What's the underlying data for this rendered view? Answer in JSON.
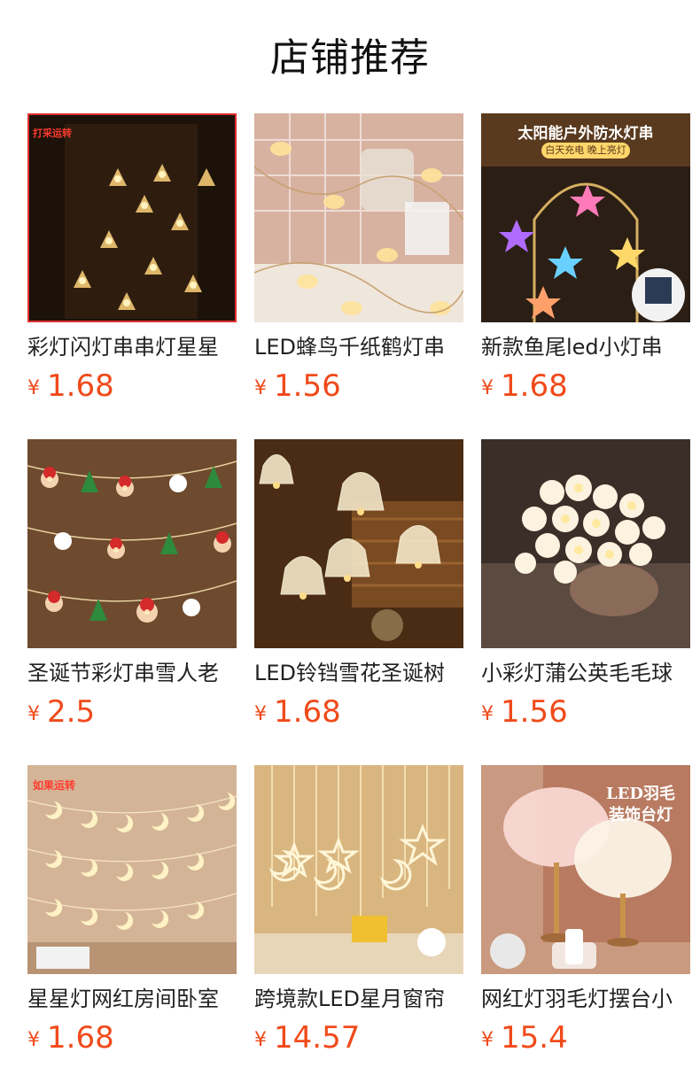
{
  "header": {
    "title": "店铺推荐"
  },
  "currency_symbol": "¥",
  "products": [
    {
      "name": "彩灯闪灯串串灯星星",
      "price": "1.68",
      "badge": "打采运转",
      "theme": "tree-lights"
    },
    {
      "name": "LED蜂鸟千纸鹤灯串",
      "price": "1.56",
      "theme": "bird-lights"
    },
    {
      "name": "新款鱼尾led小灯串",
      "price": "1.68",
      "banner_title": "太阳能户外防水灯串",
      "banner_sub": "白天充电  晚上亮灯",
      "theme": "starfish-lights"
    },
    {
      "name": "圣诞节彩灯串雪人老",
      "price": "2.5",
      "theme": "santa-lights"
    },
    {
      "name": "LED铃铛雪花圣诞树",
      "price": "1.68",
      "theme": "bell-lights"
    },
    {
      "name": "小彩灯蒲公英毛毛球",
      "price": "1.56",
      "theme": "dandelion-lights"
    },
    {
      "name": "星星灯网红房间卧室",
      "price": "1.68",
      "badge": "如果运转",
      "theme": "moon-lights"
    },
    {
      "name": "跨境款LED星月窗帘",
      "price": "14.57",
      "theme": "curtain-lights"
    },
    {
      "name": "网红灯羽毛灯摆台小",
      "price": "15.4",
      "banner_title_1": "LED羽毛",
      "banner_title_2": "装饰台灯",
      "theme": "feather-lamp"
    }
  ],
  "colors": {
    "price": "#f04a1a",
    "title": "#111111",
    "name": "#222222"
  }
}
